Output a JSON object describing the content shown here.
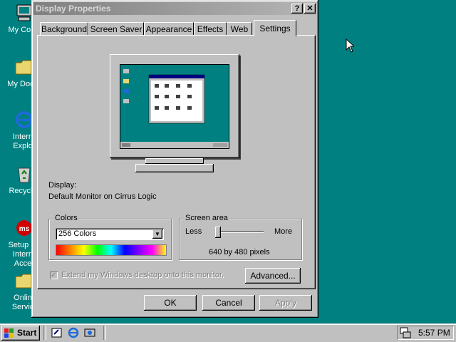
{
  "desktop": {
    "icons": [
      {
        "label": "My Com",
        "icon": "my-computer-icon"
      },
      {
        "label": "My Docu",
        "icon": "folder-icon"
      },
      {
        "label": "Intern\nExplo",
        "icon": "internet-explorer-icon"
      },
      {
        "label": "Recycle",
        "icon": "recycle-bin-icon"
      },
      {
        "label": "Setup M\nIntern\nAcce",
        "icon": "msn-icon"
      },
      {
        "label": "Onlin\nServic",
        "icon": "folder-icon"
      }
    ]
  },
  "window": {
    "title": "Display Properties",
    "help_label": "?",
    "close_label": "✕",
    "tabs": [
      {
        "label": "Background"
      },
      {
        "label": "Screen Saver"
      },
      {
        "label": "Appearance"
      },
      {
        "label": "Effects"
      },
      {
        "label": "Web"
      },
      {
        "label": "Settings",
        "active": true
      }
    ]
  },
  "settings": {
    "display_label": "Display:",
    "display_value": "Default Monitor on Cirrus Logic",
    "colors": {
      "group_label": "Colors",
      "selected": "256 Colors",
      "arrow": "▼"
    },
    "screen_area": {
      "group_label": "Screen area",
      "less_label": "Less",
      "more_label": "More",
      "value_text": "640 by 480 pixels",
      "slider_position": 0
    },
    "extend_checkbox": {
      "label": "Extend my Windows desktop onto this monitor.",
      "checked": true,
      "disabled": true,
      "mark": "✓"
    },
    "advanced_label": "Advanced..."
  },
  "buttons": {
    "ok_label": "OK",
    "cancel_label": "Cancel",
    "apply_label": "Apply"
  },
  "taskbar": {
    "start_label": "Start",
    "clock": "5:57 PM"
  },
  "colors": {
    "desktop": "#008080",
    "face": "#c0c0c0",
    "title_inactive_start": "#808080"
  }
}
